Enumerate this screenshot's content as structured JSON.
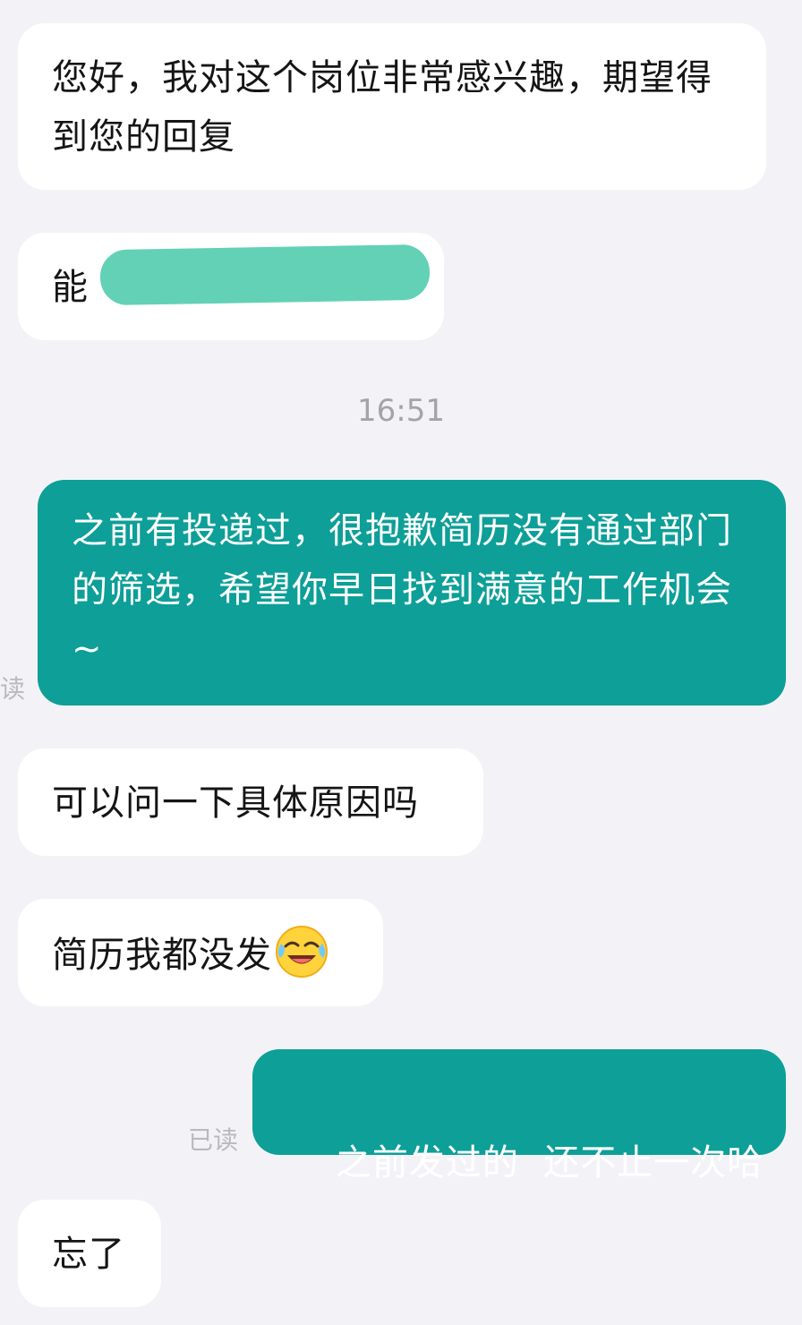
{
  "chat": {
    "timestamp": "16:51",
    "read_status": "已读",
    "read_status_partial": "读",
    "messages": [
      {
        "side": "incoming",
        "text": "您好，我对这个岗位非常感兴趣，期望得到您的回复"
      },
      {
        "side": "incoming",
        "text": "能",
        "redacted": true
      },
      {
        "side": "outgoing",
        "text": "之前有投递过，很抱歉简历没有通过部门的筛选，希望你早日找到满意的工作机会~"
      },
      {
        "side": "incoming",
        "text": "可以问一下具体原因吗"
      },
      {
        "side": "incoming",
        "text": "简历我都没发",
        "emoji": "laughing-tears-emoji"
      },
      {
        "side": "outgoing",
        "text": "之前发过的  还不止一次哈"
      },
      {
        "side": "incoming",
        "text": "忘了"
      }
    ]
  },
  "colors": {
    "background": "#f3f3f7",
    "incoming_bubble": "#ffffff",
    "outgoing_bubble": "#0d9f98",
    "redaction": "#5ccfb2",
    "timestamp_text": "#a3a3a8"
  }
}
